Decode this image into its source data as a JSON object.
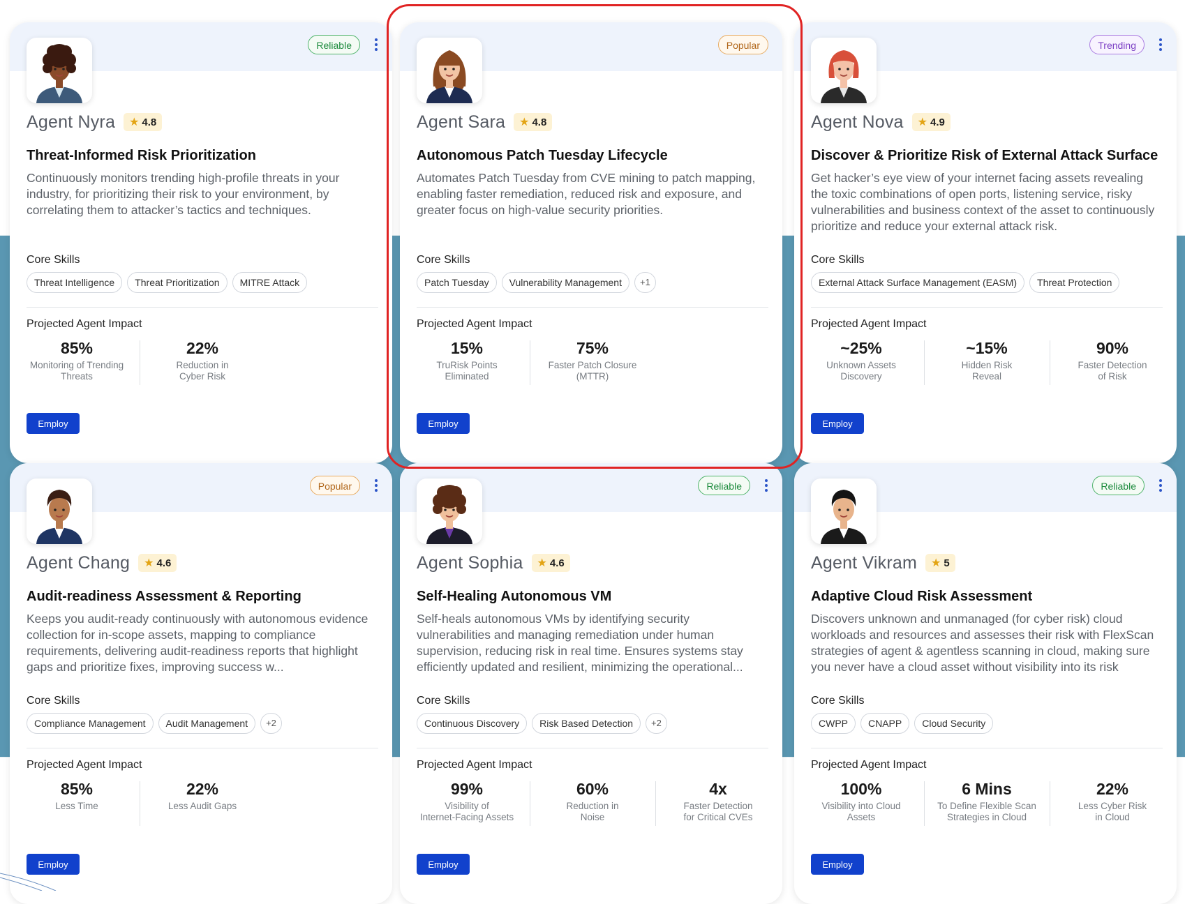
{
  "cards": [
    {
      "badge": "Reliable",
      "badge_type": "reliable",
      "agent": "Agent Nyra",
      "rating": "4.8",
      "title": "Threat-Informed Risk Prioritization",
      "desc": "Continuously monitors trending high-profile threats in your industry, for prioritizing their risk to your environment, by correlating them to attacker’s tactics and techniques.",
      "skills_label": "Core Skills",
      "skills": [
        "Threat Intelligence",
        "Threat Prioritization",
        "MITRE Attack"
      ],
      "impact_label": "Projected Agent Impact",
      "metrics": [
        {
          "value": "85%",
          "label": "Monitoring of Trending\nThreats"
        },
        {
          "value": "22%",
          "label": "Reduction in\nCyber Risk"
        }
      ],
      "employ": "Employ",
      "avatar": {
        "skin": "#8a4b2a",
        "hair": "#3a1a10",
        "suit": "#3d5a7a",
        "shirt": "#d8e8f0",
        "hairStyle": "curly"
      }
    },
    {
      "badge": "Popular",
      "badge_type": "popular",
      "agent": "Agent Sara",
      "rating": "4.8",
      "title": "Autonomous Patch Tuesday Lifecycle",
      "desc": "Automates Patch Tuesday from CVE mining to patch mapping, enabling faster remediation, reduced risk and exposure, and greater focus on high-value security priorities.",
      "skills_label": "Core Skills",
      "skills": [
        "Patch Tuesday",
        "Vulnerability Management",
        "+1"
      ],
      "impact_label": "Projected Agent Impact",
      "metrics": [
        {
          "value": "15%",
          "label": "TruRisk Points\nEliminated"
        },
        {
          "value": "75%",
          "label": "Faster Patch Closure\n(MTTR)"
        }
      ],
      "employ": "Employ",
      "avatar": {
        "skin": "#f2c4a4",
        "hair": "#8a4a22",
        "suit": "#1e2c52",
        "shirt": "#ffffff",
        "hairStyle": "long"
      }
    },
    {
      "badge": "Trending",
      "badge_type": "trending",
      "agent": "Agent Nova",
      "rating": "4.9",
      "title": "Discover & Prioritize Risk of External Attack Surface",
      "desc": "Get hacker’s eye view of your internet facing assets revealing the toxic combinations of open ports, listening service, risky vulnerabilities and business context of the asset to continuously prioritize and reduce your external attack risk.",
      "skills_label": "Core Skills",
      "skills": [
        "External Attack Surface Management (EASM)",
        "Threat Protection"
      ],
      "impact_label": "Projected Agent Impact",
      "metrics": [
        {
          "value": "~25%",
          "label": "Unknown Assets\nDiscovery"
        },
        {
          "value": "~15%",
          "label": "Hidden Risk\nReveal"
        },
        {
          "value": "90%",
          "label": "Faster Detection\nof Risk"
        }
      ],
      "employ": "Employ",
      "avatar": {
        "skin": "#f4c2a8",
        "hair": "#d8503a",
        "suit": "#2a2a2a",
        "shirt": "#e8e8e8",
        "hairStyle": "bob"
      }
    },
    {
      "badge": "Popular",
      "badge_type": "popular",
      "agent": "Agent Chang",
      "rating": "4.6",
      "title": "Audit-readiness Assessment & Reporting",
      "desc": "Keeps you audit-ready continuously with autonomous evidence collection for in-scope assets, mapping to compliance requirements, delivering audit-readiness reports that highlight gaps and prioritize fixes, improving success w...",
      "skills_label": "Core Skills",
      "skills": [
        "Compliance Management",
        "Audit Management",
        "+2"
      ],
      "impact_label": "Projected Agent Impact",
      "metrics": [
        {
          "value": "85%",
          "label": "Less Time"
        },
        {
          "value": "22%",
          "label": "Less Audit Gaps"
        }
      ],
      "employ": "Employ",
      "avatar": {
        "skin": "#b87a4e",
        "hair": "#3a1e14",
        "suit": "#1f3563",
        "shirt": "#ffffff",
        "hairStyle": "short"
      }
    },
    {
      "badge": "Reliable",
      "badge_type": "reliable",
      "agent": "Agent Sophia",
      "rating": "4.6",
      "title": "Self-Healing Autonomous VM",
      "desc": "Self-heals autonomous VMs by identifying security vulnerabilities and managing remediation under human supervision, reducing risk in real time. Ensures systems stay efficiently updated and resilient, minimizing the operational...",
      "skills_label": "Core Skills",
      "skills": [
        "Continuous Discovery",
        "Risk Based Detection",
        "+2"
      ],
      "impact_label": "Projected Agent Impact",
      "metrics": [
        {
          "value": "99%",
          "label": "Visibility of\nInternet-Facing Assets"
        },
        {
          "value": "60%",
          "label": "Reduction in\nNoise"
        },
        {
          "value": "4x",
          "label": "Faster Detection\nfor Critical CVEs"
        }
      ],
      "employ": "Employ",
      "avatar": {
        "skin": "#f0c09c",
        "hair": "#5a2c16",
        "suit": "#1c1c2a",
        "shirt": "#6a3aa8",
        "hairStyle": "curly"
      }
    },
    {
      "badge": "Reliable",
      "badge_type": "reliable",
      "agent": "Agent Vikram",
      "rating": "5",
      "title": "Adaptive Cloud Risk Assessment",
      "desc": "Discovers unknown and unmanaged (for cyber risk) cloud workloads and resources and assesses their risk with FlexScan strategies of agent & agentless scanning in cloud, making sure you never have a cloud asset without visibility into its risk",
      "skills_label": "Core Skills",
      "skills": [
        "CWPP",
        "CNAPP",
        "Cloud Security"
      ],
      "impact_label": "Projected Agent Impact",
      "metrics": [
        {
          "value": "100%",
          "label": "Visibility into Cloud\nAssets"
        },
        {
          "value": "6 Mins",
          "label": "To Define Flexible Scan\nStrategies in Cloud"
        },
        {
          "value": "22%",
          "label": "Less Cyber Risk\nin Cloud"
        }
      ],
      "employ": "Employ",
      "avatar": {
        "skin": "#e8b48c",
        "hair": "#141414",
        "suit": "#1a1a1a",
        "shirt": "#ffffff",
        "hairStyle": "short"
      }
    }
  ]
}
